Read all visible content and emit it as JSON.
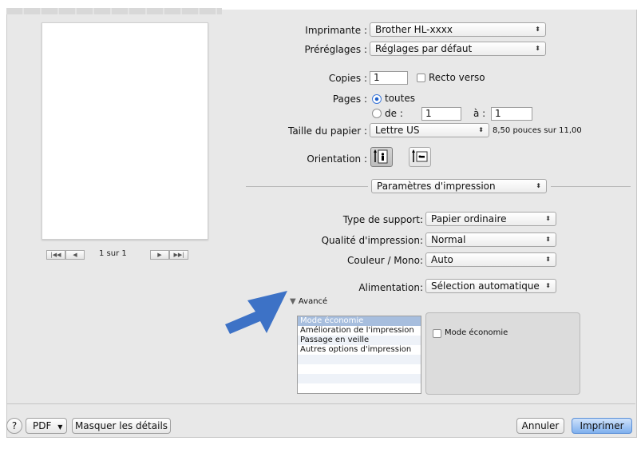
{
  "preview": {
    "page_count": "1 sur 1",
    "nav_first": "|◀◀",
    "nav_prev": "◀",
    "nav_next": "▶",
    "nav_last": "▶▶|"
  },
  "printer": {
    "label": "Imprimante :",
    "value": "Brother HL-xxxx"
  },
  "presets": {
    "label": "Préréglages :",
    "value": "Réglages par défaut"
  },
  "copies": {
    "label": "Copies :",
    "value": "1",
    "duplex_label": "Recto verso",
    "duplex_checked": false
  },
  "pages": {
    "label": "Pages :",
    "all_label": "toutes",
    "all_selected": true,
    "from_label": "de :",
    "from_value": "1",
    "to_label": "à :",
    "to_value": "1"
  },
  "paper": {
    "label": "Taille du papier :",
    "value": "Lettre US",
    "dims": "8,50 pouces sur 11,00"
  },
  "orientation": {
    "label": "Orientation :",
    "portrait_icon": "portrait-orientation-icon",
    "landscape_icon": "landscape-orientation-icon",
    "selected": "portrait"
  },
  "section": {
    "value": "Paramètres d'impression"
  },
  "settings": {
    "media_type": {
      "label": "Type de support:",
      "value": "Papier ordinaire"
    },
    "quality": {
      "label": "Qualité d'impression:",
      "value": "Normal"
    },
    "color": {
      "label": "Couleur / Mono:",
      "value": "Auto"
    },
    "source": {
      "label": "Alimentation:",
      "value": "Sélection automatique"
    }
  },
  "advanced": {
    "label": "Avancé",
    "expanded": true,
    "items": [
      {
        "label": "Mode économie",
        "selected": true
      },
      {
        "label": "Amélioration de l'impression",
        "selected": false
      },
      {
        "label": "Passage en veille",
        "selected": false
      },
      {
        "label": "Autres options d'impression",
        "selected": false
      }
    ],
    "panel_checkbox_label": "Mode économie",
    "panel_checkbox_checked": false
  },
  "annotation": {
    "arrow_icon": "arrow-pointer-icon",
    "color": "#3d72c6"
  },
  "footer": {
    "help": "?",
    "pdf": "PDF",
    "hide_details": "Masquer les détails",
    "cancel": "Annuler",
    "print": "Imprimer"
  }
}
